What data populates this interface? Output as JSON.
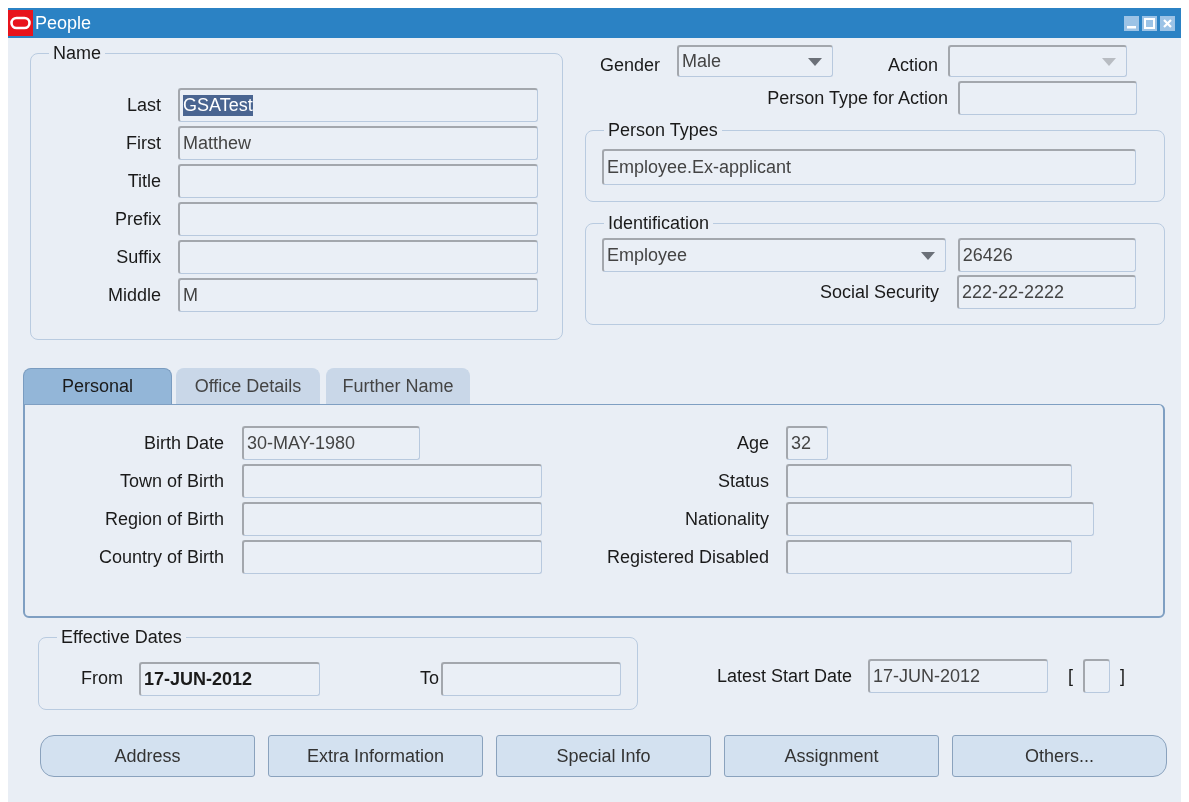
{
  "window": {
    "title": "People"
  },
  "name_group": {
    "title": "Name",
    "fields": [
      {
        "label": "Last",
        "value": "GSATest",
        "highlighted": true
      },
      {
        "label": "First",
        "value": "Matthew",
        "highlighted": false
      },
      {
        "label": "Title"
      },
      {
        "label": "Prefix"
      },
      {
        "label": "Suffix"
      },
      {
        "label": "Middle",
        "value": "M",
        "highlighted": false
      }
    ]
  },
  "gender": {
    "label": "Gender",
    "value": "Male",
    "disabled": false
  },
  "action": {
    "label": "Action",
    "disabled": true
  },
  "person_type_for_action": {
    "label": "Person Type for Action"
  },
  "person_types": {
    "title": "Person Types",
    "value": "Employee.Ex-applicant"
  },
  "identification": {
    "title": "Identification",
    "type_value": "Employee",
    "number": "26426",
    "ssn_label": "Social Security",
    "ssn": "222-22-2222"
  },
  "tabs": [
    {
      "label": "Personal",
      "selected": true
    },
    {
      "label": "Office Details",
      "selected": false
    },
    {
      "label": "Further Name",
      "selected": false
    }
  ],
  "personal": {
    "left": [
      {
        "label": "Birth Date",
        "value": "30-MAY-1980"
      },
      {
        "label": "Town of Birth"
      },
      {
        "label": "Region of Birth"
      },
      {
        "label": "Country of Birth"
      }
    ],
    "right": [
      {
        "label": "Age",
        "value": "32"
      },
      {
        "label": "Status"
      },
      {
        "label": "Nationality"
      },
      {
        "label": "Registered Disabled"
      }
    ]
  },
  "effective_dates": {
    "title": "Effective Dates",
    "from_label": "From",
    "from_value": "17-JUN-2012",
    "to_label": "To"
  },
  "latest_start": {
    "label": "Latest Start Date",
    "value": "17-JUN-2012",
    "open_bracket": "[",
    "close_bracket": "]"
  },
  "buttons": [
    {
      "label": "Address"
    },
    {
      "label": "Extra Information"
    },
    {
      "label": "Special Info"
    },
    {
      "label": "Assignment"
    },
    {
      "label": "Others..."
    }
  ]
}
